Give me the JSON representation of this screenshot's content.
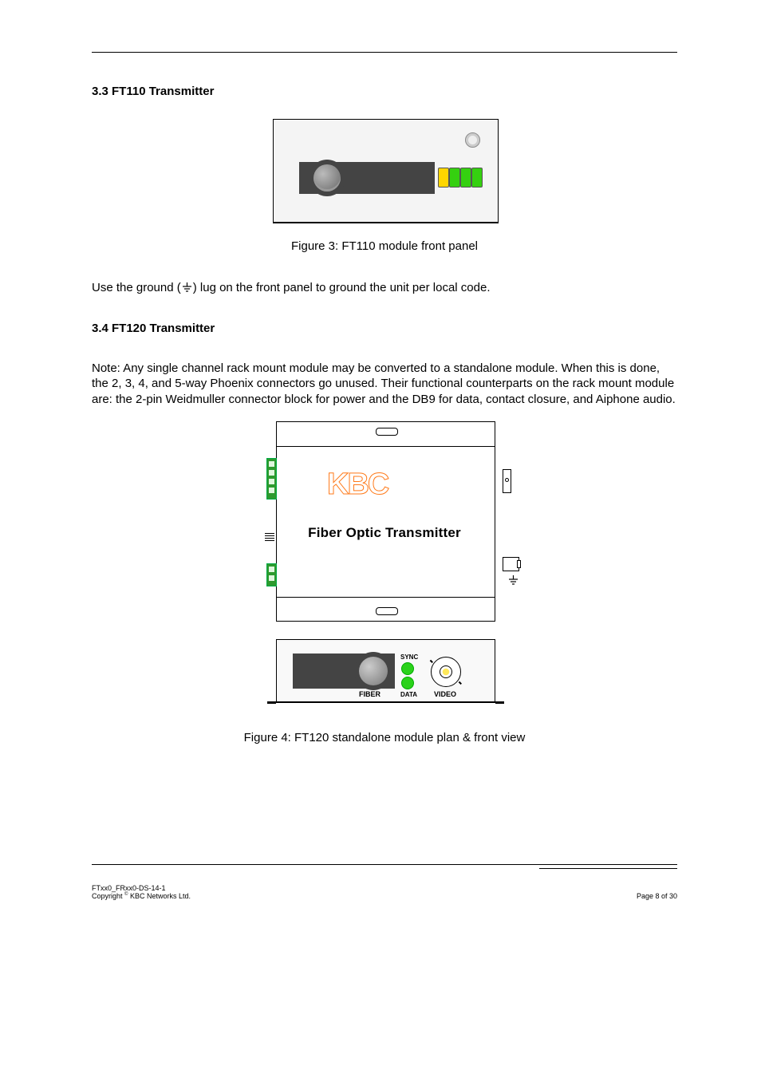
{
  "header_rule": true,
  "section3_3": {
    "heading": "3.3 FT110 Transmitter",
    "fig_caption": "Figure 3: FT110 module front panel",
    "para1_pre": "Use the ground (",
    "para1_post": ") lug on the front panel to ground the unit per local code."
  },
  "section3_4": {
    "heading": "3.4 FT120 Transmitter",
    "note": "Note: Any single channel rack mount module may be converted to a standalone module.  When this is done, the 2, 3, 4, and 5-way Phoenix connectors go unused.  Their functional counterparts on the rack mount module are: the 2-pin Weidmuller connector block for power and the DB9 for data, contact closure, and Aiphone audio.",
    "device_logo": "KBC",
    "device_label": "Fiber Optic Transmitter",
    "front_labels": {
      "sync": "SYNC",
      "data": "DATA",
      "fiber": "FIBER",
      "video": "VIDEO"
    },
    "fig_caption": "Figure 4: FT120 standalone module plan & front view"
  },
  "footer": {
    "left_line1": "FTxx0_FRxx0-DS-14-1",
    "left_line2_prefix": "Copyright ",
    "left_line2_suffix": " KBC Networks Ltd.",
    "right": "Page 8 of 30"
  }
}
